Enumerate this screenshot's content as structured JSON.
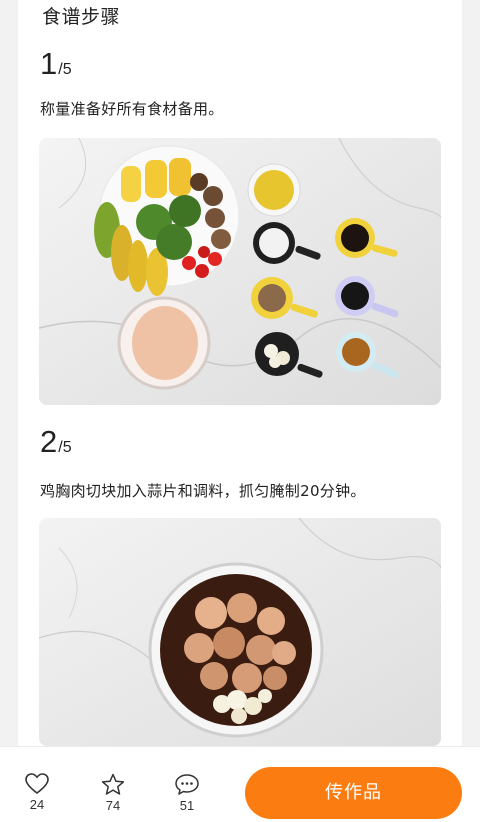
{
  "header": {
    "title": "食谱步骤"
  },
  "steps": [
    {
      "num": "1",
      "total": "/5",
      "text": "称量准备好所有食材备用。",
      "image": "ingredients-photo"
    },
    {
      "num": "2",
      "total": "/5",
      "text": "鸡胸肉切块加入蒜片和调料，抓匀腌制20分钟。",
      "image": "marinated-chicken-photo"
    }
  ],
  "bottom_bar": {
    "like": {
      "icon": "heart-icon",
      "count": "24"
    },
    "favorite": {
      "icon": "star-icon",
      "count": "74"
    },
    "comment": {
      "icon": "comment-icon",
      "count": "51"
    },
    "upload_label": "传作品",
    "accent_color": "#fb7d12"
  }
}
